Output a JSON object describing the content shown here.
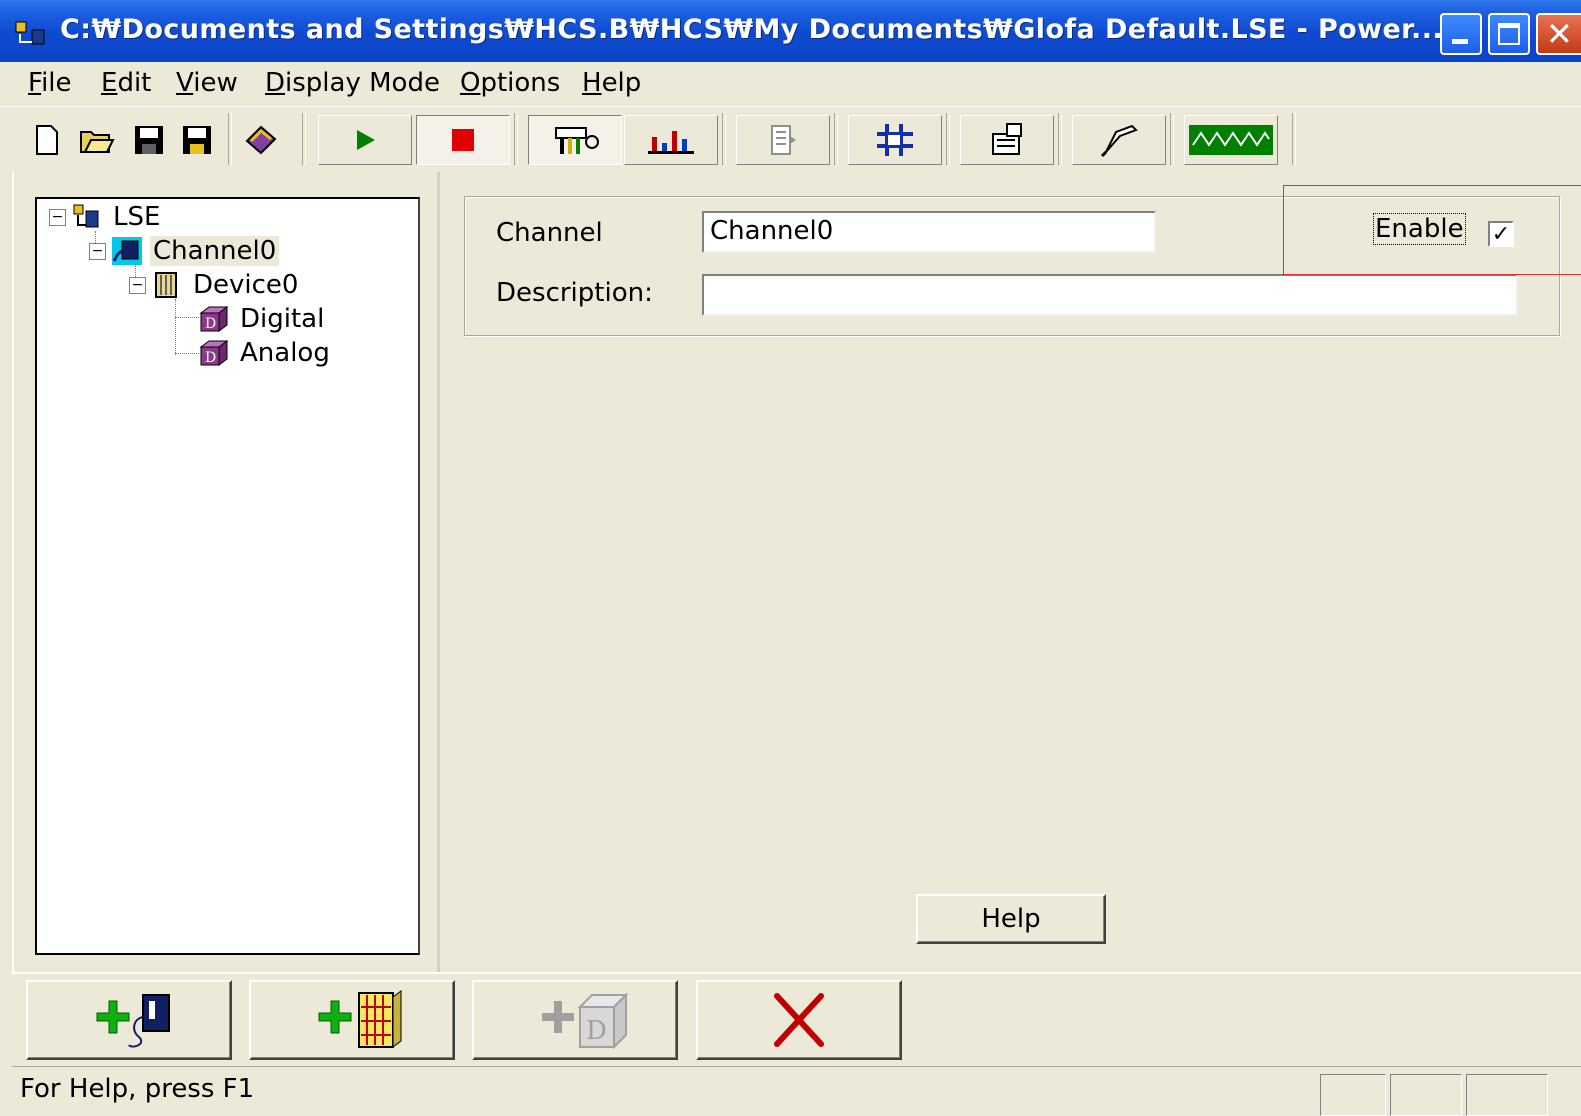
{
  "window": {
    "title": "C:₩Documents and Settings₩HCS.B₩HCS₩My Documents₩Glofa Default.LSE - Power...",
    "controls": [
      "minimize-icon",
      "maximize-icon",
      "close-icon"
    ]
  },
  "menu": {
    "items": [
      "File",
      "Edit",
      "View",
      "Display Mode",
      "Options",
      "Help"
    ]
  },
  "toolbar": {
    "buttons": [
      "new-file-icon",
      "open-folder-icon",
      "save-icon",
      "save-as-icon",
      "book-icon",
      "run-icon",
      "stop-icon",
      "tools-icon",
      "bar-chart-icon",
      "document-icon",
      "grid-icon",
      "properties-icon",
      "probe-icon",
      "signal-icon"
    ],
    "colors": {
      "run": "#008000",
      "stop": "#E00000",
      "bars": "#C00000"
    }
  },
  "tree": {
    "root": {
      "label": "LSE"
    },
    "channel": {
      "label": "Channel0"
    },
    "device": {
      "label": "Device0"
    },
    "items": [
      {
        "label": "Digital"
      },
      {
        "label": "Analog"
      }
    ],
    "expander": "−"
  },
  "form": {
    "channel_label": "Channel",
    "channel_value": "Channel0",
    "description_label": "Description:",
    "description_value": "",
    "enable_label": "Enable",
    "enable_checked": true,
    "enable_mark": "✓",
    "help_button": "Help"
  },
  "actions": {
    "buttons": [
      "add-channel-icon",
      "add-device-icon",
      "add-data-block-icon",
      "delete-icon"
    ],
    "delete_color": "#C00000"
  },
  "status": {
    "text": "For Help, press F1"
  }
}
